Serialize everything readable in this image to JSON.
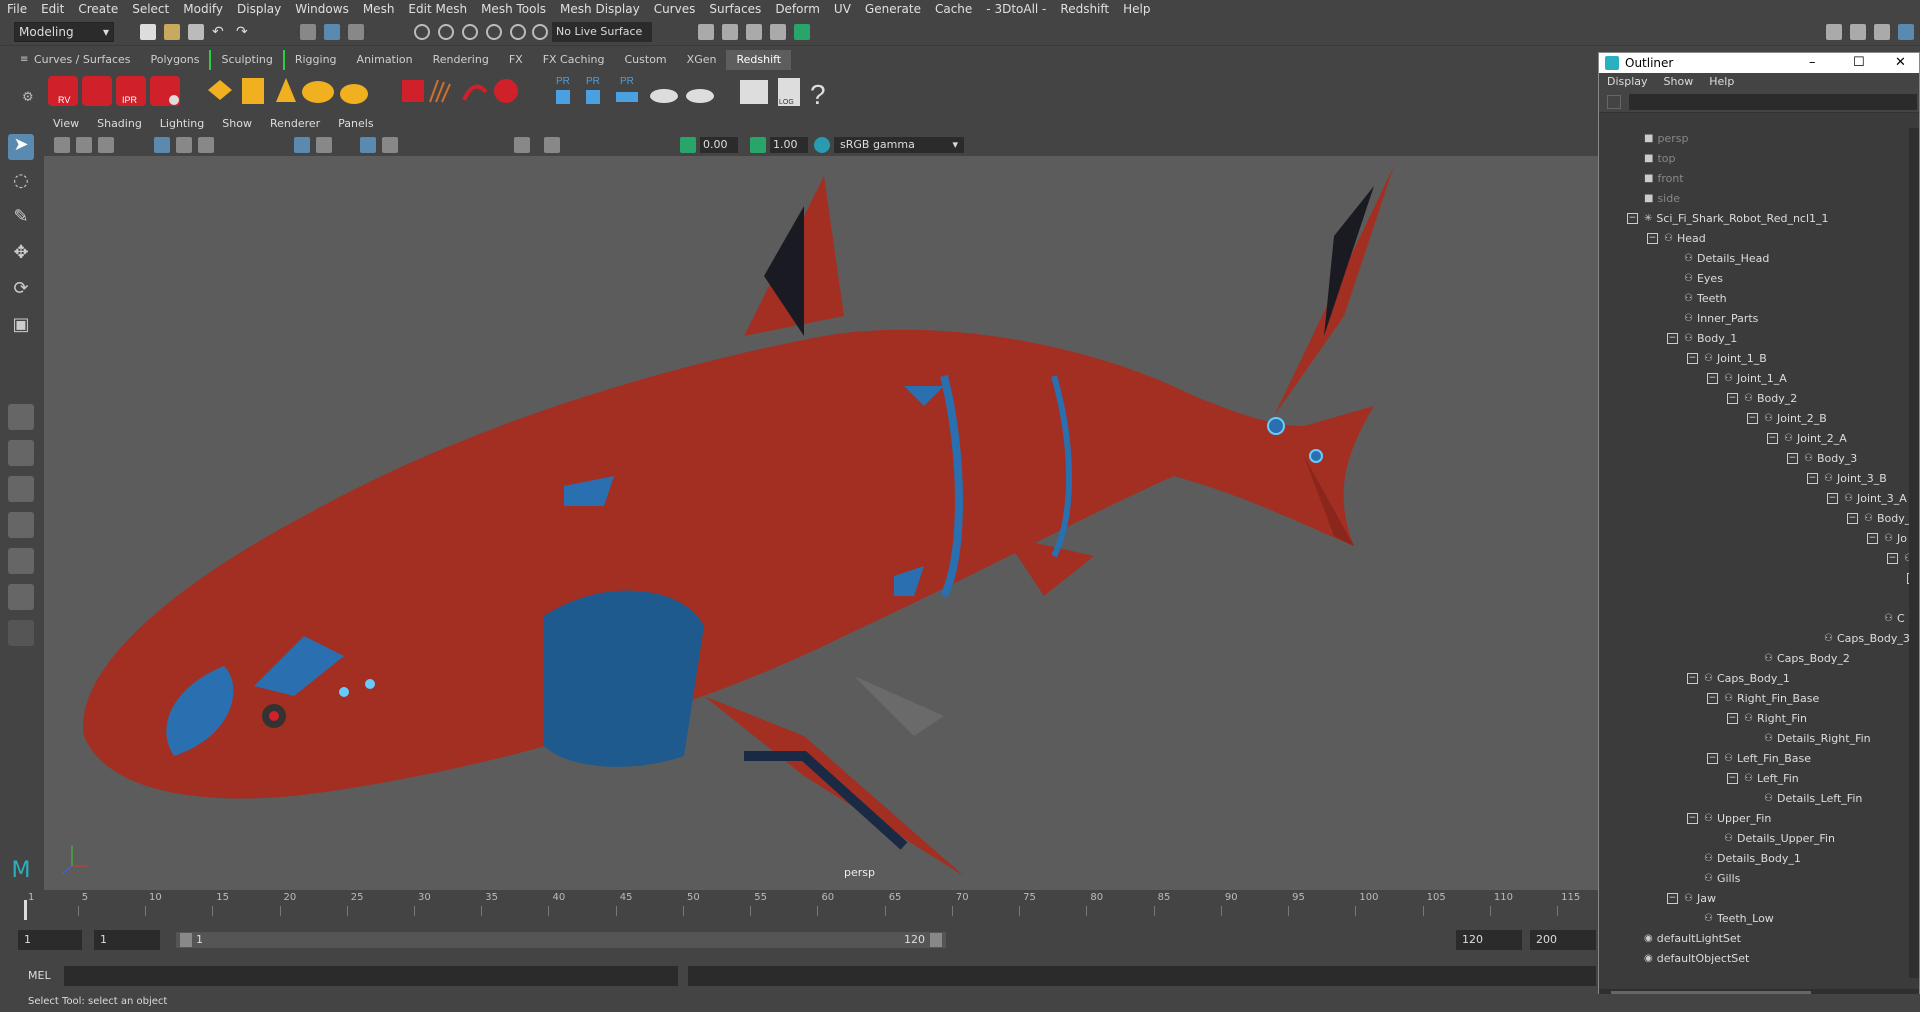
{
  "menubar": [
    "File",
    "Edit",
    "Create",
    "Select",
    "Modify",
    "Display",
    "Windows",
    "Mesh",
    "Edit Mesh",
    "Mesh Tools",
    "Mesh Display",
    "Curves",
    "Surfaces",
    "Deform",
    "UV",
    "Generate",
    "Cache",
    "- 3DtoAll -",
    "Redshift",
    "Help"
  ],
  "status": {
    "mode": "Modeling",
    "live_surface": "No Live Surface"
  },
  "shelf_tabs": [
    "Curves / Surfaces",
    "Polygons",
    "Sculpting",
    "Rigging",
    "Animation",
    "Rendering",
    "FX",
    "FX Caching",
    "Custom",
    "XGen",
    "Redshift"
  ],
  "shelf_active": "Redshift",
  "shelf_labels": {
    "rv": "RV",
    "ipr": "IPR",
    "pr1": "PR",
    "pr2": "PR",
    "pr3": "PR",
    "log": "LOG",
    "help": "?"
  },
  "viewport": {
    "menu": [
      "View",
      "Shading",
      "Lighting",
      "Show",
      "Renderer",
      "Panels"
    ],
    "exposure": "0.00",
    "gamma_value": "1.00",
    "color_space": "sRGB gamma",
    "camera": "persp"
  },
  "outliner": {
    "title": "Outliner",
    "menu": [
      "Display",
      "Show",
      "Help"
    ],
    "items": [
      {
        "label": "persp",
        "depth": 1,
        "dim": true,
        "icon": "camera-icon"
      },
      {
        "label": "top",
        "depth": 1,
        "dim": true,
        "icon": "camera-icon"
      },
      {
        "label": "front",
        "depth": 1,
        "dim": true,
        "icon": "camera-icon"
      },
      {
        "label": "side",
        "depth": 1,
        "dim": true,
        "icon": "camera-icon"
      },
      {
        "label": "Sci_Fi_Shark_Robot_Red_ncl1_1",
        "depth": 1,
        "exp": "−",
        "icon": "transform-icon"
      },
      {
        "label": "Head",
        "depth": 2,
        "exp": "−",
        "icon": "group-icon"
      },
      {
        "label": "Details_Head",
        "depth": 3,
        "icon": "group-icon"
      },
      {
        "label": "Eyes",
        "depth": 3,
        "icon": "group-icon"
      },
      {
        "label": "Teeth",
        "depth": 3,
        "icon": "group-icon"
      },
      {
        "label": "Inner_Parts",
        "depth": 3,
        "icon": "group-icon"
      },
      {
        "label": "Body_1",
        "depth": 3,
        "exp": "−",
        "icon": "group-icon"
      },
      {
        "label": "Joint_1_B",
        "depth": 4,
        "exp": "−",
        "icon": "group-icon"
      },
      {
        "label": "Joint_1_A",
        "depth": 5,
        "exp": "−",
        "icon": "group-icon"
      },
      {
        "label": "Body_2",
        "depth": 6,
        "exp": "−",
        "icon": "group-icon"
      },
      {
        "label": "Joint_2_B",
        "depth": 7,
        "exp": "−",
        "icon": "group-icon"
      },
      {
        "label": "Joint_2_A",
        "depth": 8,
        "exp": "−",
        "icon": "group-icon"
      },
      {
        "label": "Body_3",
        "depth": 9,
        "exp": "−",
        "icon": "group-icon"
      },
      {
        "label": "Joint_3_B",
        "depth": 10,
        "exp": "−",
        "icon": "group-icon"
      },
      {
        "label": "Joint_3_A",
        "depth": 11,
        "exp": "−",
        "icon": "group-icon"
      },
      {
        "label": "Body_",
        "depth": 12,
        "exp": "−",
        "icon": "group-icon"
      },
      {
        "label": "Jo",
        "depth": 13,
        "exp": "−",
        "icon": "group-icon"
      },
      {
        "label": "",
        "depth": 14,
        "exp": "−",
        "icon": "group-icon"
      },
      {
        "label": "",
        "depth": 15,
        "exp": "−",
        "icon": "group-icon"
      },
      {
        "label": "",
        "depth": 16,
        "icon": "group-icon"
      },
      {
        "label": "C",
        "depth": 13,
        "icon": "group-icon"
      },
      {
        "label": "Caps_Body_3",
        "depth": 10,
        "icon": "group-icon"
      },
      {
        "label": "Caps_Body_2",
        "depth": 7,
        "icon": "group-icon"
      },
      {
        "label": "Caps_Body_1",
        "depth": 4,
        "exp": "−",
        "icon": "group-icon"
      },
      {
        "label": "Right_Fin_Base",
        "depth": 5,
        "exp": "−",
        "icon": "group-icon"
      },
      {
        "label": "Right_Fin",
        "depth": 6,
        "exp": "−",
        "icon": "group-icon"
      },
      {
        "label": "Details_Right_Fin",
        "depth": 7,
        "icon": "group-icon"
      },
      {
        "label": "Left_Fin_Base",
        "depth": 5,
        "exp": "−",
        "icon": "group-icon"
      },
      {
        "label": "Left_Fin",
        "depth": 6,
        "exp": "−",
        "icon": "group-icon"
      },
      {
        "label": "Details_Left_Fin",
        "depth": 7,
        "icon": "group-icon"
      },
      {
        "label": "Upper_Fin",
        "depth": 4,
        "exp": "−",
        "icon": "group-icon"
      },
      {
        "label": "Details_Upper_Fin",
        "depth": 5,
        "icon": "group-icon"
      },
      {
        "label": "Details_Body_1",
        "depth": 4,
        "icon": "group-icon"
      },
      {
        "label": "Gills",
        "depth": 4,
        "icon": "group-icon"
      },
      {
        "label": "Jaw",
        "depth": 3,
        "exp": "−",
        "icon": "group-icon"
      },
      {
        "label": "Teeth_Low",
        "depth": 4,
        "icon": "group-icon"
      },
      {
        "label": "defaultLightSet",
        "depth": 1,
        "icon": "set-icon"
      },
      {
        "label": "defaultObjectSet",
        "depth": 1,
        "icon": "set-icon"
      }
    ]
  },
  "timeline": {
    "ticks": [
      "1",
      "5",
      "10",
      "15",
      "20",
      "25",
      "30",
      "35",
      "40",
      "45",
      "50",
      "55",
      "60",
      "65",
      "70",
      "75",
      "80",
      "85",
      "90",
      "95",
      "100",
      "105",
      "110",
      "115"
    ]
  },
  "range": {
    "start": "1",
    "inner_start": "1",
    "slider_start": "1",
    "slider_end": "120",
    "end": "120",
    "max": "200"
  },
  "command": {
    "label": "MEL"
  },
  "help_line": "Select Tool: select an object",
  "colors": {
    "shark": "#a32f22",
    "accent_blue": "#2a6fb0",
    "shelf_red": "#d0202a",
    "shelf_yellow": "#f0b020",
    "active_green": "#2ecc40"
  }
}
